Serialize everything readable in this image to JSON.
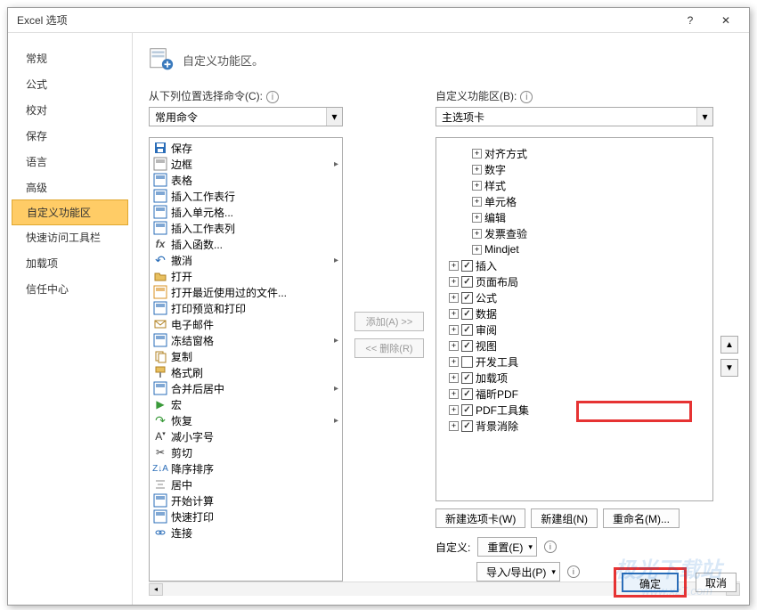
{
  "titlebar": {
    "title": "Excel 选项"
  },
  "sidebar": {
    "items": [
      {
        "label": "常规"
      },
      {
        "label": "公式"
      },
      {
        "label": "校对"
      },
      {
        "label": "保存"
      },
      {
        "label": "语言"
      },
      {
        "label": "高级"
      },
      {
        "label": "自定义功能区",
        "selected": true
      },
      {
        "label": "快速访问工具栏"
      },
      {
        "label": "加载项"
      },
      {
        "label": "信任中心"
      }
    ]
  },
  "header": {
    "text": "自定义功能区。"
  },
  "labels": {
    "choose_from": "从下列位置选择命令(C):",
    "customize_ribbon": "自定义功能区(B):"
  },
  "dropdowns": {
    "left": "常用命令",
    "right": "主选项卡"
  },
  "commands": [
    {
      "icon": "save",
      "label": "保存",
      "color": "#2a6db8"
    },
    {
      "icon": "border",
      "label": "边框",
      "sub": "▸",
      "color": "#888"
    },
    {
      "icon": "grid",
      "label": "表格",
      "color": "#2a6db8"
    },
    {
      "icon": "sheet",
      "label": "插入工作表行",
      "color": "#2a6db8"
    },
    {
      "icon": "cell",
      "label": "插入单元格...",
      "color": "#2a6db8"
    },
    {
      "icon": "col",
      "label": "插入工作表列",
      "color": "#2a6db8"
    },
    {
      "icon": "fx",
      "label": "插入函数...",
      "color": "#555"
    },
    {
      "icon": "undo",
      "label": "撤消",
      "sub": "▸",
      "color": "#d89020"
    },
    {
      "icon": "open",
      "label": "打开",
      "color": "#d89020"
    },
    {
      "icon": "recent",
      "label": "打开最近使用过的文件...",
      "color": "#d89020"
    },
    {
      "icon": "preview",
      "label": "打印预览和打印",
      "color": "#2a6db8"
    },
    {
      "icon": "mail",
      "label": "电子邮件",
      "color": "#d89020"
    },
    {
      "icon": "freeze",
      "label": "冻结窗格",
      "sub": "▸",
      "color": "#2a6db8"
    },
    {
      "icon": "copy",
      "label": "复制",
      "color": "#d89020"
    },
    {
      "icon": "fmtpaint",
      "label": "格式刷",
      "color": "#d89020"
    },
    {
      "icon": "merge",
      "label": "合并后居中",
      "sub": "▸",
      "color": "#2a6db8"
    },
    {
      "icon": "macro",
      "label": "宏",
      "color": "#3a9a3a"
    },
    {
      "icon": "redo",
      "label": "恢复",
      "sub": "▸",
      "color": "#3a9a3a"
    },
    {
      "icon": "fontdn",
      "label": "减小字号",
      "color": "#555"
    },
    {
      "icon": "cut",
      "label": "剪切",
      "color": "#d89020"
    },
    {
      "icon": "sortd",
      "label": "降序排序",
      "color": "#2a6db8"
    },
    {
      "icon": "center",
      "label": "居中",
      "color": "#888"
    },
    {
      "icon": "calc",
      "label": "开始计算",
      "color": "#2a6db8"
    },
    {
      "icon": "qprint",
      "label": "快速打印",
      "color": "#2a6db8"
    },
    {
      "icon": "link",
      "label": "连接",
      "color": "#2a6db8"
    }
  ],
  "tree": {
    "sub": [
      {
        "label": "对齐方式"
      },
      {
        "label": "数字"
      },
      {
        "label": "样式"
      },
      {
        "label": "单元格"
      },
      {
        "label": "编辑"
      },
      {
        "label": "发票查验"
      },
      {
        "label": "Mindjet"
      }
    ],
    "top": [
      {
        "label": "插入",
        "checked": true
      },
      {
        "label": "页面布局",
        "checked": true
      },
      {
        "label": "公式",
        "checked": true
      },
      {
        "label": "数据",
        "checked": true
      },
      {
        "label": "审阅",
        "checked": true
      },
      {
        "label": "视图",
        "checked": true
      },
      {
        "label": "开发工具",
        "checked": false
      },
      {
        "label": "加载项",
        "checked": true
      },
      {
        "label": "福昕PDF",
        "checked": true
      },
      {
        "label": "PDF工具集",
        "checked": true
      },
      {
        "label": "背景消除",
        "checked": true
      }
    ]
  },
  "mid": {
    "add": "添加(A) >>",
    "remove": "<< 删除(R)"
  },
  "bottom_buttons": {
    "newtab": "新建选项卡(W)",
    "newgroup": "新建组(N)",
    "rename": "重命名(M)..."
  },
  "customize": {
    "label": "自定义:",
    "reset": "重置(E)",
    "importexport": "导入/导出(P)"
  },
  "footer": {
    "ok": "确定",
    "cancel": "取消"
  },
  "watermark": {
    "main": "极光下载站",
    "sub": "www.xz7.com"
  }
}
